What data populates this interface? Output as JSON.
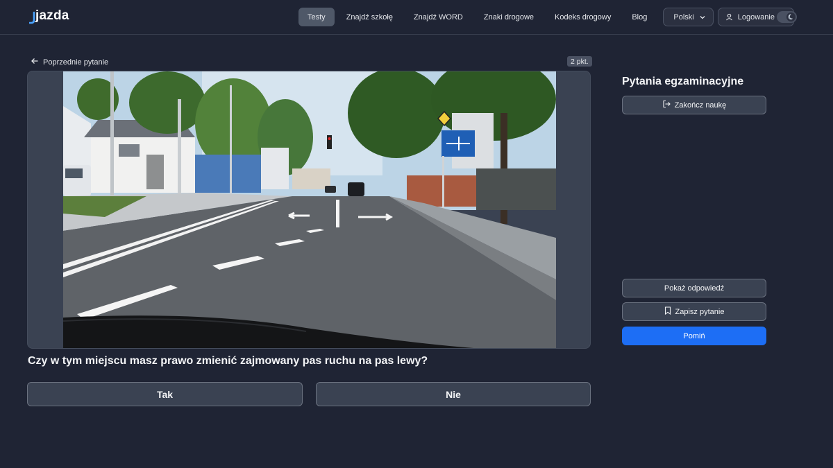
{
  "header": {
    "logo": "jazda",
    "nav": [
      {
        "label": "Testy",
        "active": true
      },
      {
        "label": "Znajdź szkołę",
        "active": false
      },
      {
        "label": "Znajdź WORD",
        "active": false
      },
      {
        "label": "Znaki drogowe",
        "active": false
      },
      {
        "label": "Kodeks drogowy",
        "active": false
      },
      {
        "label": "Blog",
        "active": false
      }
    ],
    "language": "Polski",
    "login": "Logowanie",
    "theme": "dark"
  },
  "question_panel": {
    "back_link": "Poprzednie pytanie",
    "points": "2 pkt.",
    "question": "Czy w tym miejscu masz prawo zmienić zajmowany pas ruchu na pas lewy?",
    "answers": [
      "Tak",
      "Nie"
    ]
  },
  "sidebar": {
    "title": "Pytania egzaminacyjne",
    "end_button": "Zakończ naukę",
    "show_answer_button": "Pokaż odpowiedź",
    "save_button": "Zapisz pytanie",
    "skip_button": "Pomiń"
  },
  "colors": {
    "background": "#1f2434",
    "accent": "#1d6ef5",
    "card": "#3a4252"
  }
}
